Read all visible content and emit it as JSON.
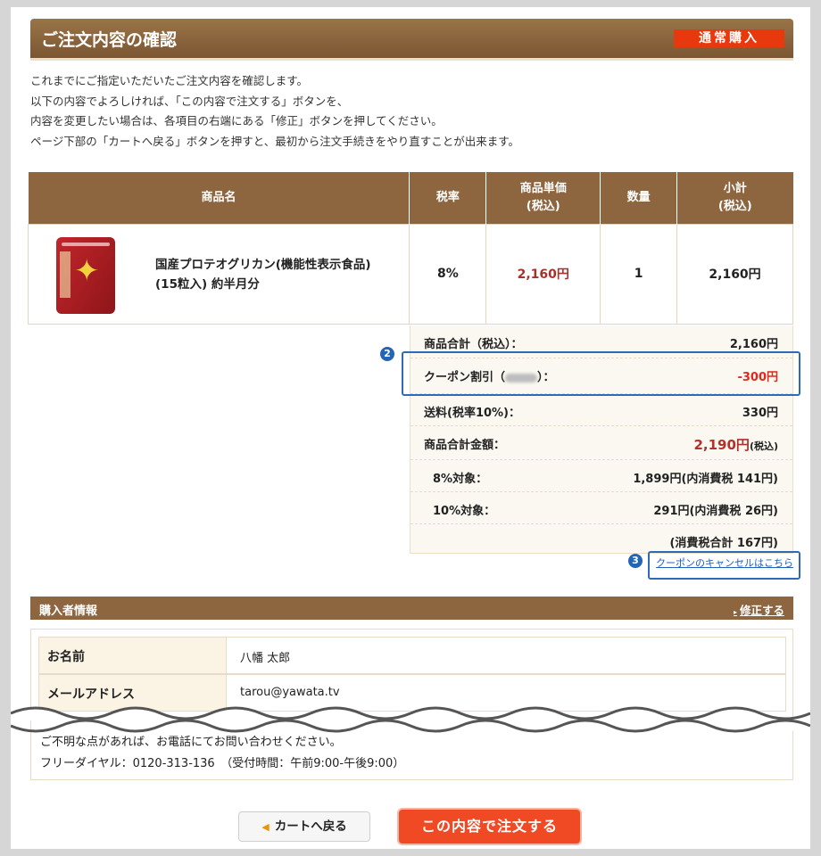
{
  "header": {
    "title": "ご注文内容の確認",
    "badge": "通常購入"
  },
  "intro": [
    "これまでにご指定いただいたご注文内容を確認します。",
    "以下の内容でよろしければ、「この内容で注文する」ボタンを、",
    "内容を変更したい場合は、各項目の右端にある「修正」ボタンを押してください。",
    "ページ下部の「カートへ戻る」ボタンを押すと、最初から注文手続きをやり直すことが出来ます。"
  ],
  "items_table": {
    "headers": {
      "name": "商品名",
      "tax_rate": "税率",
      "unit_price_1": "商品単価",
      "unit_price_2": "(税込)",
      "qty": "数量",
      "subtotal_1": "小計",
      "subtotal_2": "(税込)"
    },
    "rows": [
      {
        "name_line1": "国産プロテオグリカン(機能性表示食品)",
        "name_line2": "(15粒入) 約半月分",
        "tax_rate": "8%",
        "unit_price": "2,160円",
        "qty": "1",
        "subtotal": "2,160円"
      }
    ]
  },
  "summary": {
    "item_total_label": "商品合計（税込）：",
    "item_total_value": "2,160円",
    "coupon_label_pre": "クーポン割引（",
    "coupon_label_post": "）：",
    "coupon_value": "-300円",
    "shipping_label": "送料(税率10%)：",
    "shipping_value": "330円",
    "grand_total_label": "商品合計金額：",
    "grand_total_value": "2,190円",
    "grand_total_suffix": "(税込)",
    "tax8_label": "8%対象：",
    "tax8_value": "1,899円(内消費税 141円)",
    "tax10_label": "10%対象：",
    "tax10_value": "291円(内消費税 26円)",
    "tax_total": "(消費税合計 167円)"
  },
  "annotations": {
    "marker2": "2",
    "marker3": "3"
  },
  "cancel_coupon_link": "クーポンのキャンセルはこちら",
  "buyer": {
    "title": "購入者情報",
    "edit_label": "修正する",
    "rows": [
      {
        "key": "お名前",
        "value": "八幡 太郎"
      },
      {
        "key": "メールアドレス",
        "value": "tarou@yawata.tv"
      }
    ]
  },
  "notice": {
    "line1": "ご不明な点があれば、お電話にてお問い合わせください。",
    "line2": "フリーダイヤル：0120-313-136　（受付時間：午前9:00-午後9:00）"
  },
  "buttons": {
    "back": "カートへ戻る",
    "order": "この内容で注文する"
  },
  "colors": {
    "header_brown": "#8d6640",
    "badge_red": "#e8380d",
    "annotation_blue": "#2464b4",
    "order_button": "#ef4a24"
  }
}
